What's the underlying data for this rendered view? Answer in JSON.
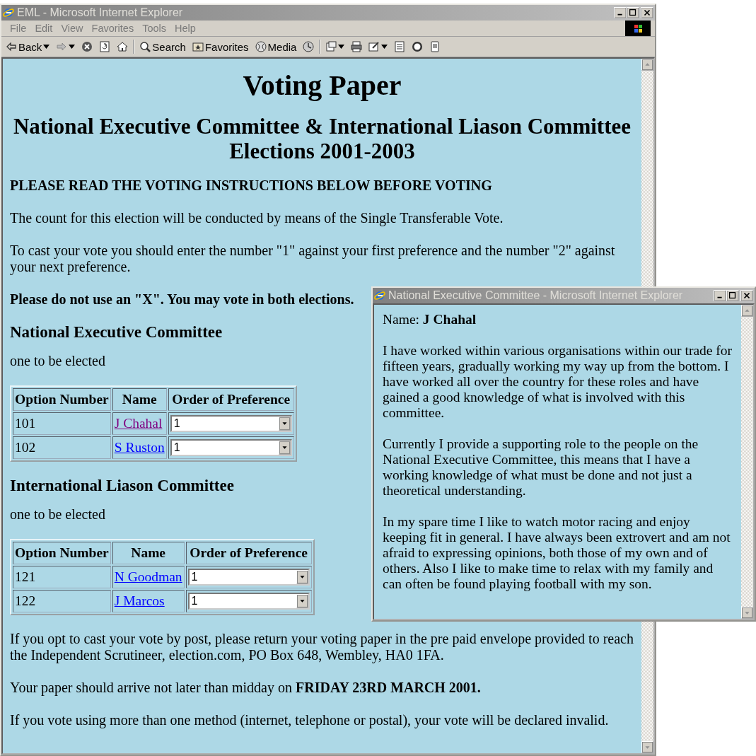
{
  "window": {
    "title": "EML - Microsoft Internet Explorer"
  },
  "menu": [
    "File",
    "Edit",
    "View",
    "Favorites",
    "Tools",
    "Help"
  ],
  "toolbar": [
    {
      "kind": "button",
      "label": "Back",
      "dropdown": true
    },
    {
      "kind": "button",
      "dropdown": true
    },
    {
      "kind": "button"
    },
    {
      "kind": "button"
    },
    {
      "kind": "button"
    },
    {
      "kind": "separator"
    },
    {
      "kind": "button",
      "label": "Search"
    },
    {
      "kind": "button",
      "label": "Favorites"
    },
    {
      "kind": "button",
      "label": "Media"
    },
    {
      "kind": "button"
    },
    {
      "kind": "separator"
    },
    {
      "kind": "button",
      "dropdown": true
    },
    {
      "kind": "button"
    },
    {
      "kind": "button",
      "dropdown": true
    },
    {
      "kind": "button"
    },
    {
      "kind": "button"
    },
    {
      "kind": "button"
    }
  ],
  "page": {
    "title": "Voting Paper",
    "subtitle": "National Executive Committee & International Liason Committee Elections 2001-2003",
    "notice": "PLEASE READ THE VOTING INSTRUCTIONS BELOW BEFORE VOTING",
    "paragraphs": [
      "The count for this election will be conducted by means of the Single Transferable Vote.",
      "To cast your vote you should enter the number \"1\" against your first preference and the number \"2\" against your next preference.",
      "**Please do not use an \"X\". You may vote in both elections.**"
    ],
    "elections": [
      {
        "title": "National Executive Committee",
        "note": "one to be elected",
        "columns": [
          "Option Number",
          "Name",
          "Order of Preference"
        ],
        "rows": [
          {
            "option": "101",
            "name": "J Chahal",
            "visited": true,
            "preference": "1"
          },
          {
            "option": "102",
            "name": "S Ruston",
            "visited": false,
            "preference": "1"
          }
        ]
      },
      {
        "title": "International Liason Committee",
        "note": "one to be elected",
        "columns": [
          "Option Number",
          "Name",
          "Order of Preference"
        ],
        "rows": [
          {
            "option": "121",
            "name": "N Goodman",
            "visited": false,
            "preference": "1"
          },
          {
            "option": "122",
            "name": "J Marcos",
            "visited": false,
            "preference": "1"
          }
        ]
      }
    ],
    "footer": [
      "If you opt to cast your vote by post, please return your voting paper in the pre paid envelope provided to reach the Independent Scrutineer, election.com, PO Box 648, Wembley, HA0 1FA.",
      "Your paper should arrive not later than midday on **FRIDAY 23RD MARCH 2001.**",
      "If you vote using more than one method (internet, telephone or postal), your vote will be declared invalid."
    ]
  },
  "popup": {
    "title": "National Executive Committee - Microsoft Internet Explorer",
    "paragraphs": [
      "Name: **J Chahal**",
      "I have worked within various organisations within our trade for fifteen years, gradually working my way up from the bottom. I have worked all over the country for these roles and have gained a good knowledge of what is involved with this committee.",
      "Currently I provide a supporting role to the people on the National Executive Committee, this means that I have a working knowledge of what must be done and not just a theoretical understanding.",
      "In my spare time I like to watch motor racing and enjoy keeping fit in general. I have always been extrovert and am not afraid to expressing opinions, both those of my own and of others. Also I like to make time to relax with my family and can often be found playing football with my son."
    ]
  }
}
